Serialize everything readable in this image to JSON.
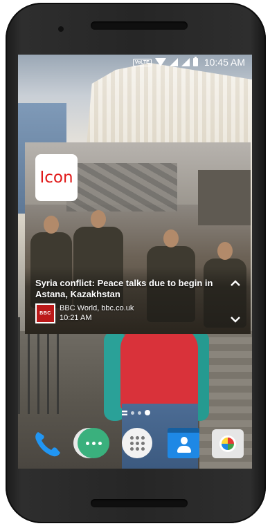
{
  "status_bar": {
    "volte": "VoLTE",
    "time": "10:45 AM"
  },
  "news_widget": {
    "icon_placeholder": "Icon",
    "headline": "Syria conflict: Peace talks due to begin in Astana, Kazakhstan",
    "source_logo": "BBC",
    "source": "BBC World, bbc.co.uk",
    "time": "10:21 AM",
    "colors": {
      "icon_text": "#e01919",
      "bbc_red": "#bb1919"
    }
  },
  "home_pages": {
    "count": 3,
    "active_index": 2
  },
  "dock": {
    "apps": [
      {
        "name": "Phone",
        "icon": "phone-icon"
      },
      {
        "name": "Messages",
        "icon": "messages-icon"
      },
      {
        "name": "All apps",
        "icon": "app-drawer-icon"
      },
      {
        "name": "Contacts",
        "icon": "contacts-icon"
      },
      {
        "name": "Camera",
        "icon": "camera-icon"
      }
    ]
  }
}
